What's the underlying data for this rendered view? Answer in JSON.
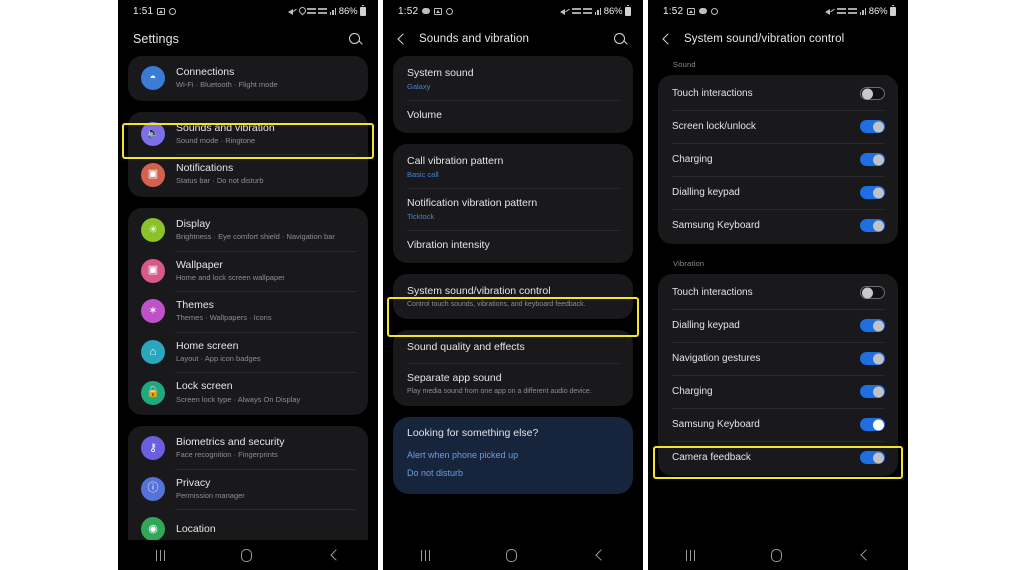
{
  "meta": {
    "highlight_color": "#f5e529",
    "accent_blue": "#4a7fd4",
    "toggle_on_color": "#1f6fe0",
    "card_bg": "#19191b",
    "tip_bg": "#16243c"
  },
  "panel1": {
    "status": {
      "time": "1:51",
      "left_icons": [
        "image-icon",
        "circle-icon"
      ],
      "right_icons": [
        "mute-icon",
        "location-pin-icon",
        "network-icon",
        "data-icon",
        "signal-bars-icon"
      ],
      "battery_pct": "86%"
    },
    "appbar": {
      "title": "Settings",
      "search_icon": "search-icon"
    },
    "groups": [
      {
        "items": [
          {
            "title": "Connections",
            "sub": "Wi-Fi  ·  Bluetooth  ·  Flight mode",
            "icon": "wifi-icon",
            "color": "#3a7bd5",
            "glyph": "◓"
          }
        ]
      },
      {
        "items": [
          {
            "title": "Sounds and vibration",
            "sub": "Sound mode  ·  Ringtone",
            "icon": "speaker-icon",
            "color": "#7d6fe8",
            "glyph": "ὐA",
            "highlighted": true
          },
          {
            "title": "Notifications",
            "sub": "Status bar  ·  Do not disturb",
            "icon": "notification-icon",
            "color": "#d4614e",
            "glyph": "▣"
          }
        ]
      },
      {
        "items": [
          {
            "title": "Display",
            "sub": "Brightness  ·  Eye comfort shield  ·  Navigation bar",
            "icon": "brightness-icon",
            "color": "#8ac22a",
            "glyph": "☀"
          },
          {
            "title": "Wallpaper",
            "sub": "Home and lock screen wallpaper",
            "icon": "wallpaper-icon",
            "color": "#d9598b",
            "glyph": "▣"
          },
          {
            "title": "Themes",
            "sub": "Themes  ·  Wallpapers  ·  Icons",
            "icon": "themes-icon",
            "color": "#c052c9",
            "glyph": "✦"
          },
          {
            "title": "Home screen",
            "sub": "Layout  ·  App icon badges",
            "icon": "home-icon",
            "color": "#2aa6bd",
            "glyph": "⌂"
          },
          {
            "title": "Lock screen",
            "sub": "Screen lock type  ·  Always On Display",
            "icon": "lock-icon",
            "color": "#20a97d",
            "glyph": "ὑ2"
          }
        ]
      },
      {
        "items": [
          {
            "title": "Biometrics and security",
            "sub": "Face recognition  ·  Fingerprints",
            "icon": "shield-icon",
            "color": "#6b5fe0",
            "glyph": "⛨"
          },
          {
            "title": "Privacy",
            "sub": "Permission manager",
            "icon": "privacy-icon",
            "color": "#5572d8",
            "glyph": "ⓘ"
          },
          {
            "title": "Location",
            "sub": "",
            "icon": "location-icon",
            "color": "#2fa85a",
            "glyph": "◉"
          }
        ]
      }
    ],
    "nav": {
      "recents": "recents-icon",
      "home": "home-icon",
      "back": "back-icon"
    }
  },
  "panel2": {
    "status": {
      "time": "1:52",
      "left_icons": [
        "chat-icon",
        "image-icon",
        "circle-icon"
      ],
      "right_icons": [
        "mute-icon",
        "network-icon",
        "data-icon",
        "signal-bars-icon"
      ],
      "battery_pct": "86%"
    },
    "appbar": {
      "title": "Sounds and vibration",
      "back_icon": "back-icon",
      "search_icon": "search-icon"
    },
    "groups": [
      {
        "items": [
          {
            "title": "System sound",
            "value": "Galaxy"
          },
          {
            "title": "Volume",
            "value": ""
          }
        ]
      },
      {
        "items": [
          {
            "title": "Call vibration pattern",
            "value": "Basic call"
          },
          {
            "title": "Notification vibration pattern",
            "value": "Ticktock"
          },
          {
            "title": "Vibration intensity",
            "value": ""
          }
        ]
      },
      {
        "items": [
          {
            "title": "System sound/vibration control",
            "value": "",
            "desc": "Control touch sounds, vibrations, and keyboard feedback.",
            "highlighted": true
          }
        ]
      },
      {
        "items": [
          {
            "title": "Sound quality and effects",
            "value": ""
          },
          {
            "title": "Separate app sound",
            "value": "",
            "desc": "Play media sound from one app on a different audio device."
          }
        ]
      }
    ],
    "tip": {
      "title": "Looking for something else?",
      "links": [
        "Alert when phone picked up",
        "Do not disturb"
      ]
    },
    "nav": {
      "recents": "recents-icon",
      "home": "home-icon",
      "back": "back-icon"
    }
  },
  "panel3": {
    "status": {
      "time": "1:52",
      "left_icons": [
        "image-icon",
        "chat-icon",
        "circle-icon"
      ],
      "right_icons": [
        "mute-icon",
        "network-icon",
        "data-icon",
        "signal-bars-icon"
      ],
      "battery_pct": "86%"
    },
    "appbar": {
      "title": "System sound/vibration control",
      "back_icon": "back-icon"
    },
    "sections": [
      {
        "label": "Sound",
        "items": [
          {
            "label": "Touch interactions",
            "on": false
          },
          {
            "label": "Screen lock/unlock",
            "on": true
          },
          {
            "label": "Charging",
            "on": true
          },
          {
            "label": "Dialling keypad",
            "on": true
          },
          {
            "label": "Samsung Keyboard",
            "on": true
          }
        ]
      },
      {
        "label": "Vibration",
        "items": [
          {
            "label": "Touch interactions",
            "on": false
          },
          {
            "label": "Dialling keypad",
            "on": true
          },
          {
            "label": "Navigation gestures",
            "on": true
          },
          {
            "label": "Charging",
            "on": true
          },
          {
            "label": "Samsung Keyboard",
            "on": true,
            "highlighted": true
          },
          {
            "label": "Camera feedback",
            "on": true
          }
        ]
      }
    ],
    "nav": {
      "recents": "recents-icon",
      "home": "home-icon",
      "back": "back-icon"
    }
  }
}
